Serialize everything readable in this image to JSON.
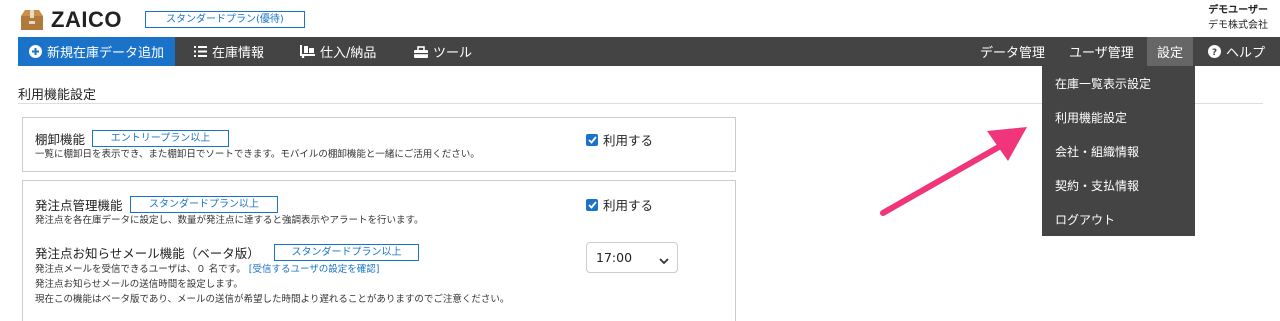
{
  "header": {
    "logo_text": "ZAICO",
    "plan_badge": "スタンダードプラン(優待)",
    "user_name": "デモユーザー",
    "company": "デモ株式会社"
  },
  "nav": {
    "add_label": "新規在庫データ追加",
    "inventory_label": "在庫情報",
    "purchase_label": "仕入/納品",
    "tools_label": "ツール",
    "data_mgmt_label": "データ管理",
    "user_mgmt_label": "ユーザ管理",
    "settings_label": "設定",
    "help_label": "ヘルプ"
  },
  "settings_menu": [
    {
      "label": "在庫一覧表示設定"
    },
    {
      "label": "利用機能設定"
    },
    {
      "label": "会社・組織情報"
    },
    {
      "label": "契約・支払情報"
    },
    {
      "label": "ログアウト"
    }
  ],
  "page": {
    "title": "利用機能設定"
  },
  "features": {
    "tanaoroshi": {
      "name": "棚卸機能",
      "tag": "エントリープラン以上",
      "description": "一覧に棚卸日を表示でき、また棚卸日でソートできます。モバイルの棚卸機能と一緒にご活用ください。",
      "checkbox_label": "利用する",
      "enabled": true
    },
    "reorder_point": {
      "name": "発注点管理機能",
      "tag": "スタンダードプラン以上",
      "description": "発注点を各在庫データに設定し、数量が発注点に達すると強調表示やアラートを行います。",
      "checkbox_label": "利用する",
      "enabled": true
    },
    "reorder_mail": {
      "name": "発注点お知らせメール機能（ベータ版）",
      "tag": "スタンダードプラン以上",
      "desc_line1_prefix": "発注点メールを受信できるユーザは、０ 名です。",
      "desc_line1_link": "[受信するユーザの設定を確認]",
      "desc_line2": "発注点お知らせメールの送信時間を設定します。",
      "desc_line3": "現在この機能はベータ版であり、メールの送信が希望した時間より遅れることがありますのでご注意ください。",
      "send_time": "17:00"
    }
  },
  "colors": {
    "accent_blue": "#1a73c9",
    "nav_bg": "#444444",
    "arrow": "#f0357a"
  }
}
